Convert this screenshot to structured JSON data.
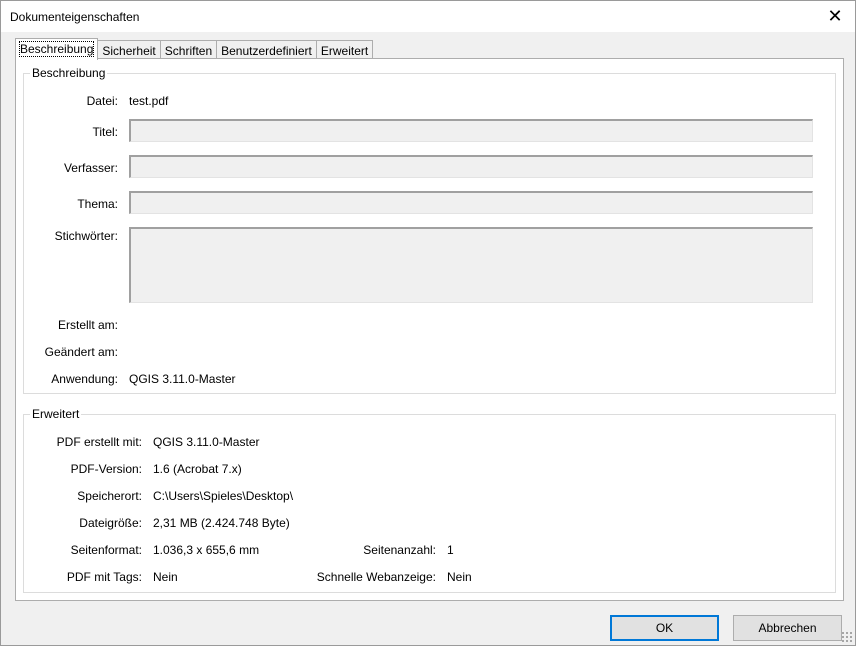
{
  "window": {
    "title": "Dokumenteigenschaften"
  },
  "icons": {
    "close": "close-icon"
  },
  "tabs": [
    "Beschreibung",
    "Sicherheit",
    "Schriften",
    "Benutzerdefiniert",
    "Erweitert"
  ],
  "beschreibung": {
    "group_title": "Beschreibung",
    "datei_label": "Datei:",
    "datei_value": "test.pdf",
    "titel_label": "Titel:",
    "titel_value": "",
    "verfasser_label": "Verfasser:",
    "verfasser_value": "",
    "thema_label": "Thema:",
    "thema_value": "",
    "stichwoerter_label": "Stichwörter:",
    "stichwoerter_value": "",
    "erstellt_label": "Erstellt am:",
    "geaendert_label": "Geändert am:",
    "anwendung_label": "Anwendung:",
    "anwendung_value": "QGIS 3.11.0-Master"
  },
  "erweitert": {
    "group_title": "Erweitert",
    "pdf_erstellt_label": "PDF erstellt mit:",
    "pdf_erstellt_value": "QGIS 3.11.0-Master",
    "pdf_version_label": "PDF-Version:",
    "pdf_version_value": "1.6 (Acrobat 7.x)",
    "speicherort_label": "Speicherort:",
    "speicherort_value": "C:\\Users\\Spieles\\Desktop\\",
    "dateigroesse_label": "Dateigröße:",
    "dateigroesse_value": "2,31 MB (2.424.748 Byte)",
    "seitenformat_label": "Seitenformat:",
    "seitenformat_value": "1.036,3 x 655,6 mm",
    "seitenanzahl_label": "Seitenanzahl:",
    "seitenanzahl_value": "1",
    "tags_label": "PDF mit Tags:",
    "tags_value": "Nein",
    "webanzeige_label": "Schnelle Webanzeige:",
    "webanzeige_value": "Nein"
  },
  "buttons": {
    "ok": "OK",
    "cancel": "Abbrechen"
  }
}
